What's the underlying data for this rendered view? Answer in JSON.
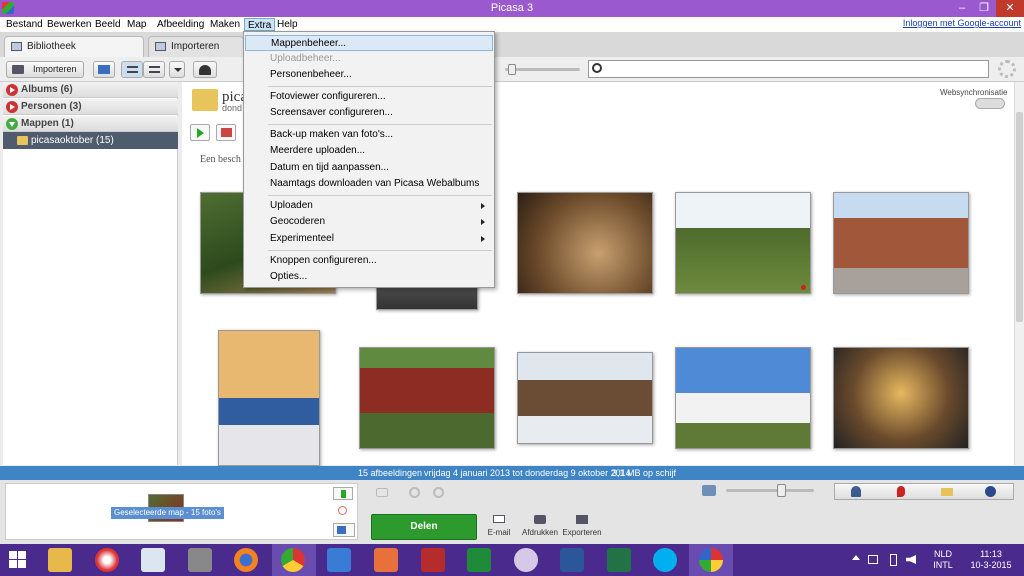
{
  "window": {
    "title": "Picasa 3"
  },
  "menubar": {
    "items": [
      "Bestand",
      "Bewerken",
      "Beeld",
      "Map",
      "Afbeelding",
      "Maken",
      "Extra",
      "Help"
    ],
    "login": "Inloggen met Google-account"
  },
  "tabs": [
    {
      "label": "Bibliotheek"
    },
    {
      "label": "Importeren"
    }
  ],
  "toolbar": {
    "import_label": "Importeren"
  },
  "sidebar": {
    "albums": "Albums (6)",
    "persons": "Personen (3)",
    "folders": "Mappen (1)",
    "folder_item": "picasaoktober (15)"
  },
  "main": {
    "folder_title": "pica",
    "folder_date": "dond",
    "description_placeholder": "Een besch",
    "websync_label": "Websynchronisatie"
  },
  "dropdown": {
    "items": [
      {
        "label": "Mappenbeheer...",
        "state": "highlighted"
      },
      {
        "label": "Uploadbeheer...",
        "state": "disabled"
      },
      {
        "label": "Personenbeheer...",
        "state": "normal"
      },
      {
        "label": "Fotoviewer configureren...",
        "state": "normal"
      },
      {
        "label": "Screensaver configureren...",
        "state": "normal"
      },
      {
        "label": "Back-up maken van foto's...",
        "state": "normal"
      },
      {
        "label": "Meerdere uploaden...",
        "state": "normal"
      },
      {
        "label": "Datum en tijd aanpassen...",
        "state": "normal"
      },
      {
        "label": "Naamtags downloaden van Picasa Webalbums",
        "state": "normal"
      },
      {
        "label": "Uploaden",
        "state": "submenu"
      },
      {
        "label": "Geocoderen",
        "state": "submenu"
      },
      {
        "label": "Experimenteel",
        "state": "submenu"
      },
      {
        "label": "Knoppen configureren...",
        "state": "normal"
      },
      {
        "label": "Opties...",
        "state": "normal"
      }
    ]
  },
  "statusbar": {
    "count": "15 afbeeldingen",
    "range": "vrijdag 4 januari 2013 tot donderdag 9 oktober 2014",
    "size": "3,1 MB op schijf"
  },
  "tray": {
    "selection_label": "Geselecteerde map - 15 foto's",
    "share_label": "Delen",
    "email_label": "E-mail",
    "print_label": "Afdrukken",
    "export_label": "Exporteren"
  },
  "taskbar": {
    "lang_top": "NLD",
    "lang_bottom": "INTL",
    "time": "11:13",
    "date": "10-3-2015"
  },
  "colors": {
    "titlebar": "#9b59d0",
    "statusbar": "#3f84c4",
    "taskbar": "#4a2a8c",
    "share_button": "#2d9a2d"
  }
}
